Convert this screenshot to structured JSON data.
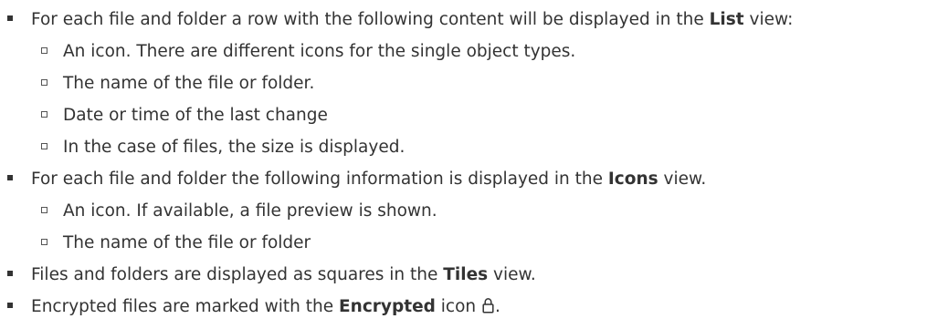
{
  "bullets": [
    {
      "pre": "For each file and folder a row with the following content will be displayed in the ",
      "bold": "List",
      "post": " view:",
      "subitems": [
        "An icon. There are different icons for the single object types.",
        "The name of the file or folder.",
        "Date or time of the last change",
        "In the case of files, the size is displayed."
      ]
    },
    {
      "pre": "For each file and folder the following information is displayed in the ",
      "bold": "Icons",
      "post": " view.",
      "subitems": [
        "An icon. If available, a file preview is shown.",
        "The name of the file or folder"
      ]
    },
    {
      "pre": "Files and folders are displayed as squares in the ",
      "bold": "Tiles",
      "post": " view."
    },
    {
      "pre": "Encrypted files are marked with the ",
      "bold": "Encrypted",
      "mid": " icon ",
      "icon": "lock-icon",
      "post": "."
    }
  ]
}
